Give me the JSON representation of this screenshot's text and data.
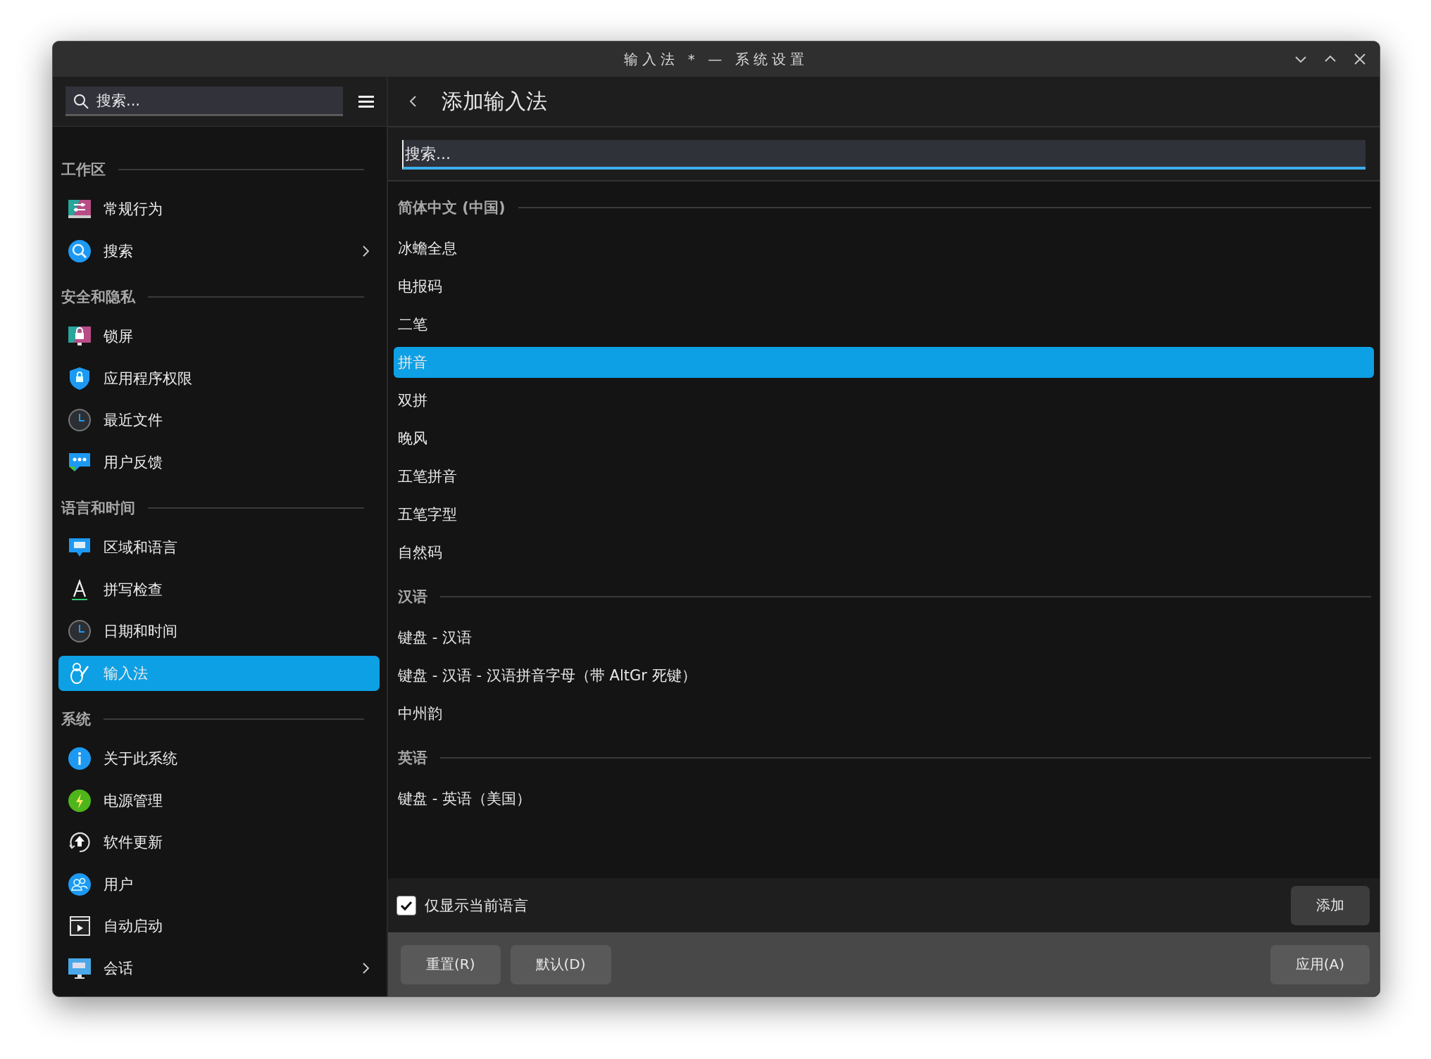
{
  "window": {
    "title": "输入法 * — 系统设置"
  },
  "sidebar": {
    "search": {
      "placeholder": "搜索..."
    },
    "sections": [
      {
        "title": "工作区",
        "items": [
          {
            "label": "常规行为",
            "selected": false,
            "submenu": false
          },
          {
            "label": "搜索",
            "selected": false,
            "submenu": true
          }
        ]
      },
      {
        "title": "安全和隐私",
        "items": [
          {
            "label": "锁屏",
            "selected": false,
            "submenu": false
          },
          {
            "label": "应用程序权限",
            "selected": false,
            "submenu": false
          },
          {
            "label": "最近文件",
            "selected": false,
            "submenu": false
          },
          {
            "label": "用户反馈",
            "selected": false,
            "submenu": false
          }
        ]
      },
      {
        "title": "语言和时间",
        "items": [
          {
            "label": "区域和语言",
            "selected": false,
            "submenu": false
          },
          {
            "label": "拼写检查",
            "selected": false,
            "submenu": false
          },
          {
            "label": "日期和时间",
            "selected": false,
            "submenu": false
          },
          {
            "label": "输入法",
            "selected": true,
            "submenu": false
          }
        ]
      },
      {
        "title": "系统",
        "items": [
          {
            "label": "关于此系统",
            "selected": false,
            "submenu": false
          },
          {
            "label": "电源管理",
            "selected": false,
            "submenu": false
          },
          {
            "label": "软件更新",
            "selected": false,
            "submenu": false
          },
          {
            "label": "用户",
            "selected": false,
            "submenu": false
          },
          {
            "label": "自动启动",
            "selected": false,
            "submenu": false
          },
          {
            "label": "会话",
            "selected": false,
            "submenu": true
          }
        ]
      }
    ]
  },
  "page": {
    "title": "添加输入法",
    "search": {
      "placeholder": "搜索...",
      "focused": true
    },
    "groups": [
      {
        "title": "简体中文 (中国)",
        "items": [
          {
            "label": "冰蟾全息",
            "selected": false
          },
          {
            "label": "电报码",
            "selected": false
          },
          {
            "label": "二笔",
            "selected": false
          },
          {
            "label": "拼音",
            "selected": true
          },
          {
            "label": "双拼",
            "selected": false
          },
          {
            "label": "晚风",
            "selected": false
          },
          {
            "label": "五笔拼音",
            "selected": false
          },
          {
            "label": "五笔字型",
            "selected": false
          },
          {
            "label": "自然码",
            "selected": false
          }
        ]
      },
      {
        "title": "汉语",
        "items": [
          {
            "label": "键盘 - 汉语",
            "selected": false
          },
          {
            "label": "键盘 - 汉语 - 汉语拼音字母（带 AltGr 死键）",
            "selected": false
          },
          {
            "label": "中州韵",
            "selected": false
          }
        ]
      },
      {
        "title": "英语",
        "items": [
          {
            "label": "键盘 - 英语（美国）",
            "selected": false
          }
        ]
      }
    ],
    "only_current_language": {
      "label": "仅显示当前语言",
      "checked": true
    },
    "add_button": "添加"
  },
  "footer": {
    "buttons": [
      "重置(R)",
      "默认(D)"
    ],
    "apply_button": "应用(A)"
  }
}
